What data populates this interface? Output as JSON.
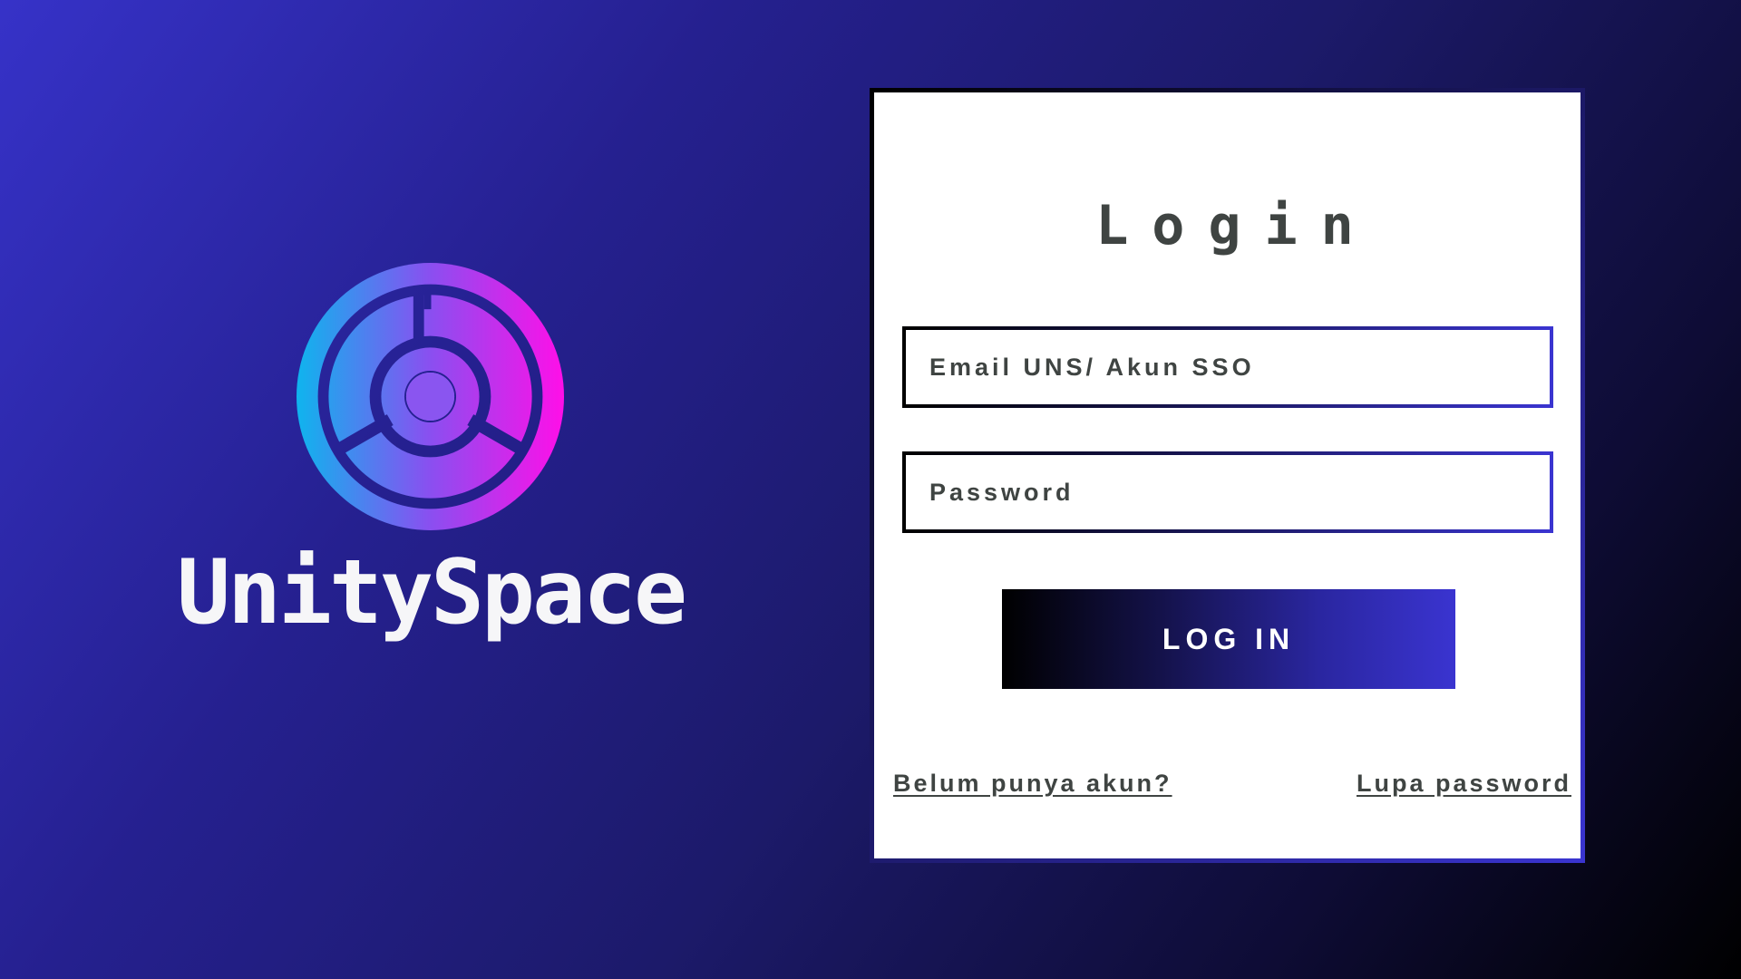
{
  "brand": {
    "name": "UnitySpace",
    "logo_icon": "unityspace-logo-icon",
    "logo_gradient": [
      "#0fb4ee",
      "#8a4ff0",
      "#ff0fe8"
    ]
  },
  "login": {
    "title": "Login",
    "email_placeholder": "Email UNS/ Akun SSO",
    "email_value": "",
    "password_placeholder": "Password",
    "password_value": "",
    "submit_label": "LOG IN",
    "register_link": "Belum punya akun?",
    "forgot_link": "Lupa password"
  },
  "colors": {
    "background_start": "#3632c8",
    "background_end": "#000000",
    "accent": "#3a34d0",
    "text": "#3f4442",
    "card": "#ffffff"
  }
}
